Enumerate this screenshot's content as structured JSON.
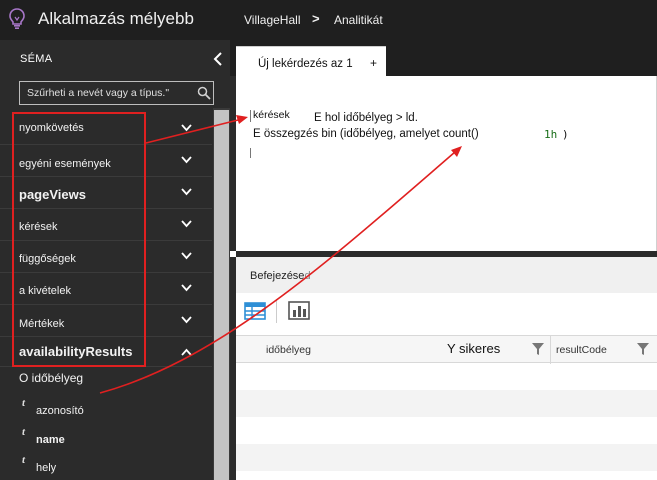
{
  "header": {
    "app_title": "Alkalmazás mélyebb",
    "breadcrumb": [
      "VillageHall",
      "Analitikát"
    ],
    "breadcrumb_separator": ">"
  },
  "sidebar": {
    "title": "SÉMA",
    "search_placeholder": "Szűrheti a nevét vagy a típus.\"",
    "tables": [
      {
        "label": "nyomkövetés"
      },
      {
        "label": "egyéni események"
      },
      {
        "label": "pageViews"
      },
      {
        "label": "kérések"
      },
      {
        "label": "függőségek"
      },
      {
        "label": "a kivételek"
      },
      {
        "label": "Mértékek"
      },
      {
        "label": "availabilityResults"
      }
    ],
    "fields": [
      {
        "type": "",
        "label": "O időbélyeg"
      },
      {
        "type": "t",
        "label": "azonosító"
      },
      {
        "type": "t",
        "label": "name"
      },
      {
        "type": "t",
        "label": "hely"
      }
    ]
  },
  "tabs": {
    "active_label": "Új lekérdezés az 1",
    "add_label": "+"
  },
  "editor": {
    "line1_table": "kérések",
    "line1_where": "E hol időbélyeg > ld.",
    "line2_summarize": "E összegzés bin (időbélyeg, amelyet count()",
    "line2_bin": "1h",
    "line2_close": ")"
  },
  "results": {
    "status": "Befejezése",
    "status_suffix": "d",
    "columns": [
      "időbélyeg",
      "Y sikeres",
      "resultCode"
    ]
  },
  "colors": {
    "annotation": "#e02020",
    "accent": "#2e8fd6",
    "sidebar_bg": "#2b2b2b",
    "topbar_bg": "#1f1f1f"
  }
}
